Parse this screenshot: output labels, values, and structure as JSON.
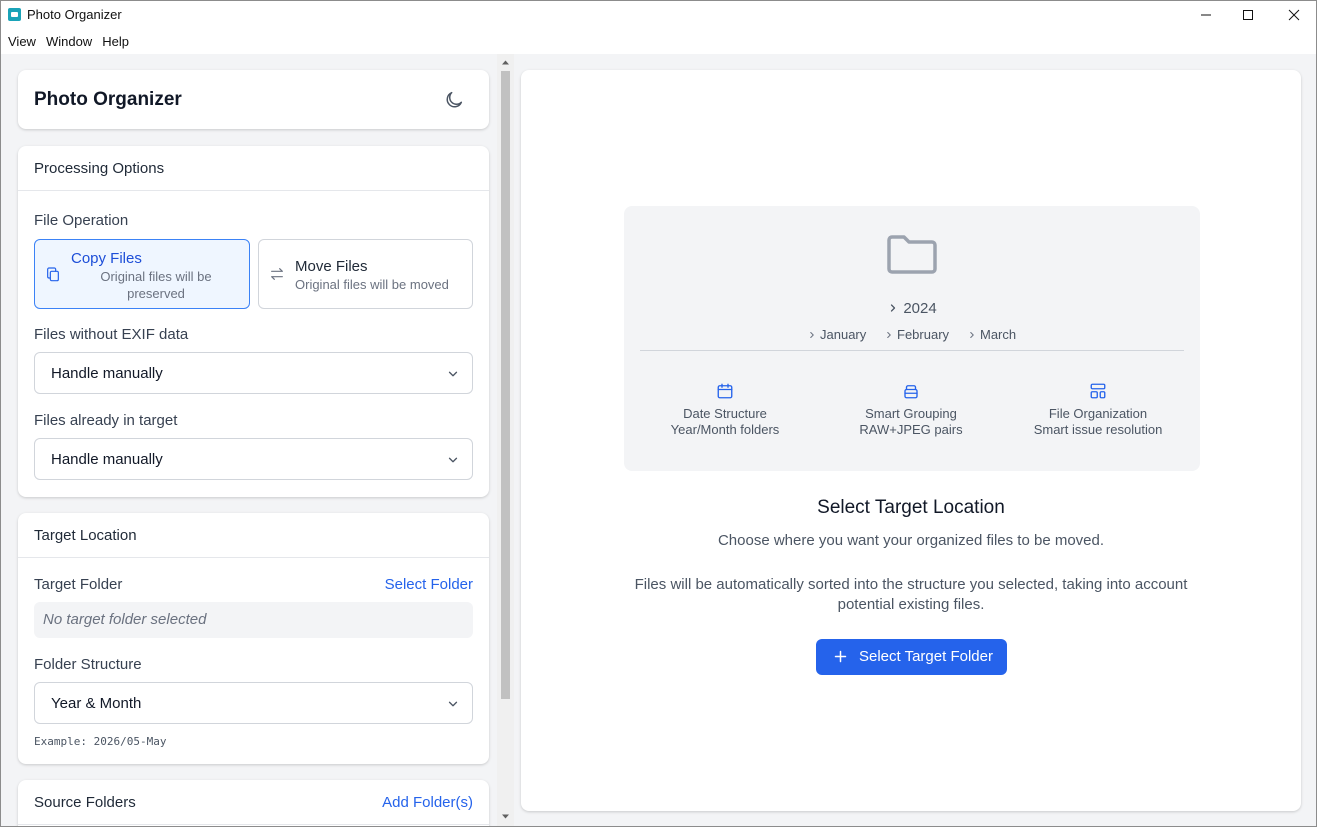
{
  "window": {
    "title": "Photo Organizer"
  },
  "menu": [
    "View",
    "Window",
    "Help"
  ],
  "header": {
    "app_title": "Photo Organizer"
  },
  "processing": {
    "section_title": "Processing Options",
    "file_operation_label": "File Operation",
    "copy": {
      "title": "Copy Files",
      "subtitle_line1": "Original files will be",
      "subtitle_line2": "preserved"
    },
    "move": {
      "title": "Move Files",
      "subtitle": "Original files will be moved"
    },
    "no_exif_label": "Files without EXIF data",
    "no_exif_value": "Handle manually",
    "in_target_label": "Files already in target",
    "in_target_value": "Handle manually"
  },
  "target": {
    "section_title": "Target Location",
    "folder_label": "Target Folder",
    "select_link": "Select Folder",
    "empty_text": "No target folder selected",
    "structure_label": "Folder Structure",
    "structure_value": "Year & Month",
    "example": "Example: 2026/05-May"
  },
  "sources": {
    "section_title": "Source Folders",
    "add_link": "Add Folder(s)"
  },
  "preview": {
    "year": "2024",
    "months": [
      "January",
      "February",
      "March"
    ],
    "features": [
      {
        "title": "Date Structure",
        "subtitle": "Year/Month folders"
      },
      {
        "title": "Smart Grouping",
        "subtitle": "RAW+JPEG pairs"
      },
      {
        "title": "File Organization",
        "subtitle": "Smart issue resolution"
      }
    ]
  },
  "main": {
    "title": "Select Target Location",
    "description": "Choose where you want your organized files to be moved.",
    "description2": "Files will be automatically sorted into the structure you selected, taking into account potential existing files.",
    "button_label": "Select Target Folder"
  },
  "colors": {
    "accent": "#2563eb",
    "active_bg": "#eff6ff",
    "active_border": "#3b82f6"
  }
}
